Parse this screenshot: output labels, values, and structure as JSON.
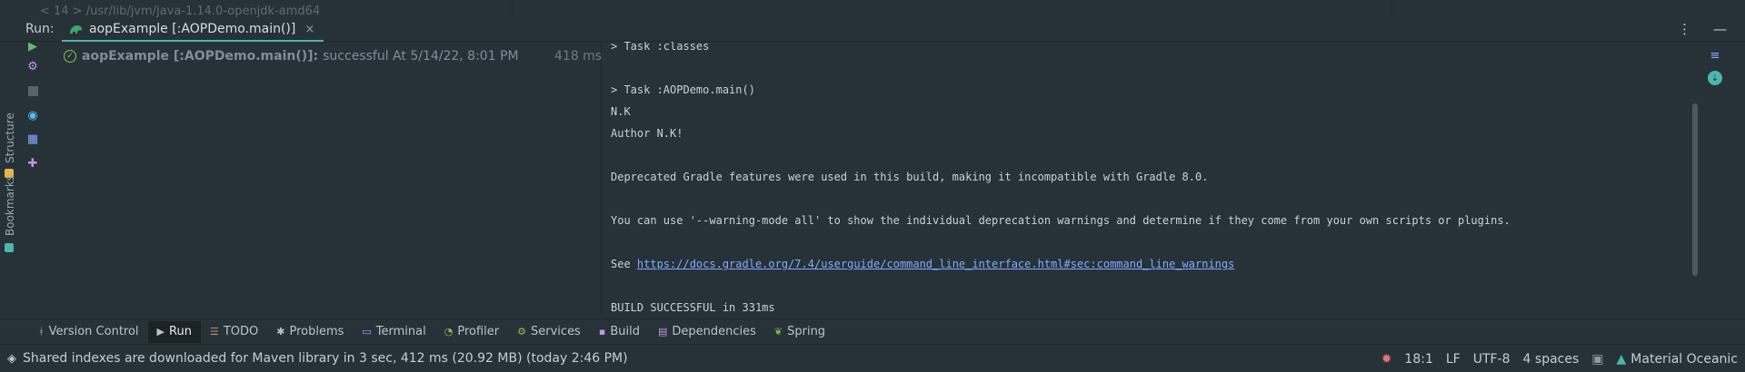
{
  "top_strip": {
    "tree_text": "< 14 > /usr/lib/jvm/java-1.14.0-openjdk-amd64"
  },
  "run_header": {
    "label": "Run:",
    "tab_label": "aopExample [:AOPDemo.main()]",
    "tab_close": "×",
    "more_glyph": "⋮",
    "minimize_glyph": "—"
  },
  "left_strip": {
    "structure": "Structure",
    "bookmarks": "Bookmarks"
  },
  "run_tree": {
    "task_name": "aopExample [:AOPDemo.main()]:",
    "status": "successful At 5/14/22, 8:01 PM",
    "duration": "418 ms"
  },
  "console": {
    "lines": [
      "> Task :classes",
      "",
      "> Task :AOPDemo.main()",
      "N.K",
      "Author N.K!",
      "",
      "Deprecated Gradle features were used in this build, making it incompatible with Gradle 8.0.",
      "",
      "You can use '--warning-mode all' to show the individual deprecation warnings and determine if they come from your own scripts or plugins.",
      "",
      "See ",
      "",
      "BUILD SUCCESSFUL in 331ms"
    ],
    "link_prefix": "See ",
    "link_url": "https://docs.gradle.org/7.4/userguide/command_line_interface.html#sec:command_line_warnings"
  },
  "bottom_tools": [
    {
      "name": "version-control",
      "label": "Version Control",
      "icon": "branch-icon",
      "glyph": "ᚼ",
      "color": "#8fb3c7",
      "active": false
    },
    {
      "name": "run",
      "label": "Run",
      "icon": "play-icon",
      "glyph": "▶",
      "color": "#b8c4ca",
      "active": true
    },
    {
      "name": "todo",
      "label": "TODO",
      "icon": "list-icon",
      "glyph": "☰",
      "color": "#d08c60",
      "active": false
    },
    {
      "name": "problems",
      "label": "Problems",
      "icon": "bug-icon",
      "glyph": "✱",
      "color": "#b8c4ca",
      "active": false
    },
    {
      "name": "terminal",
      "label": "Terminal",
      "icon": "terminal-icon",
      "glyph": "▭",
      "color": "#c792ea",
      "active": false
    },
    {
      "name": "profiler",
      "label": "Profiler",
      "icon": "profiler-icon",
      "glyph": "◔",
      "color": "#8bc34a",
      "active": false
    },
    {
      "name": "services",
      "label": "Services",
      "icon": "gear-icon",
      "glyph": "⚙",
      "color": "#8bc34a",
      "active": false
    },
    {
      "name": "build",
      "label": "Build",
      "icon": "hammer-icon",
      "glyph": "▪",
      "color": "#c792ea",
      "active": false
    },
    {
      "name": "dependencies",
      "label": "Dependencies",
      "icon": "dependencies-icon",
      "glyph": "▤",
      "color": "#c792ea",
      "active": false
    },
    {
      "name": "spring",
      "label": "Spring",
      "icon": "spring-leaf-icon",
      "glyph": "❦",
      "color": "#6cbf43",
      "active": false
    }
  ],
  "status_bar": {
    "message": "Shared indexes are downloaded for Maven library in 3 sec, 412 ms (20.92 MB) (today 2:46 PM)",
    "position": "18:1",
    "line_sep": "LF",
    "encoding": "UTF-8",
    "indent": "4 spaces",
    "theme": "Material Oceanic"
  },
  "colors": {
    "background": "#263238",
    "accent": "#4db6ac",
    "success": "#8bc34a",
    "link": "#82aaff",
    "run_green": "#66bb6a"
  }
}
